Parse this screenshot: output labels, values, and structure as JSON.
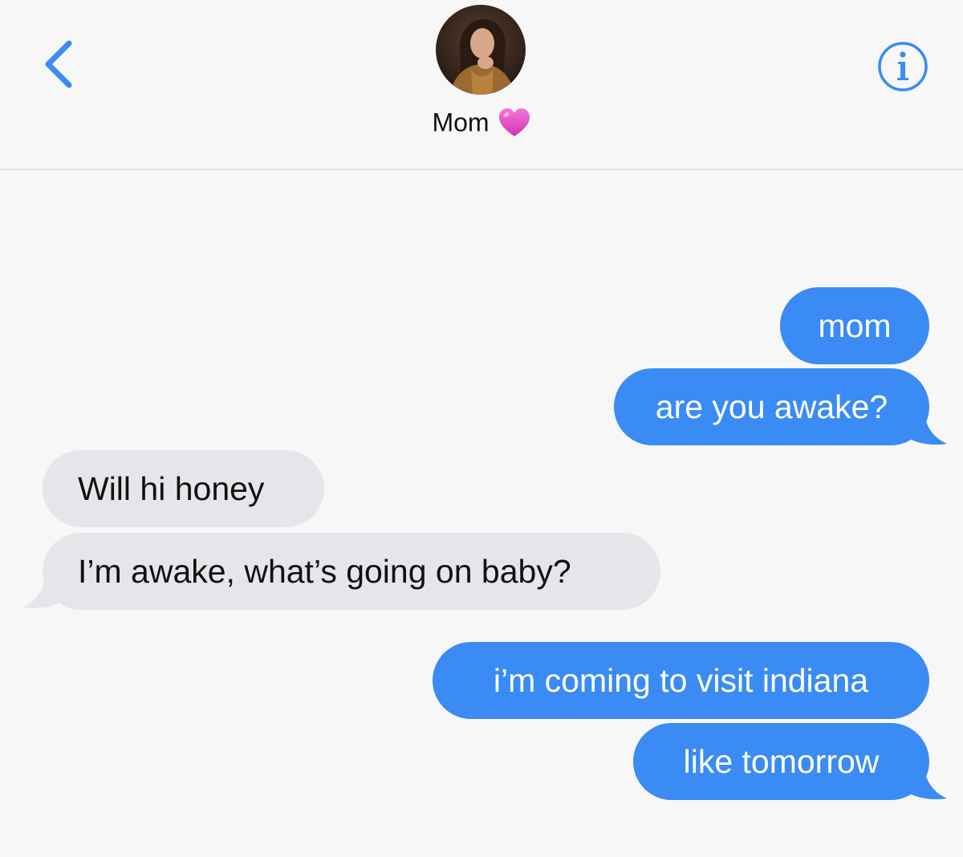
{
  "header": {
    "contact_name": "Mom",
    "contact_emoji": "pink-heart-icon",
    "back_icon": "chevron-left-icon",
    "info_icon": "info-icon",
    "accent_color": "#3a8bf3"
  },
  "messages": [
    {
      "direction": "sent",
      "text": "mom"
    },
    {
      "direction": "sent",
      "text": "are you awake?"
    },
    {
      "direction": "received",
      "text": "Will hi honey"
    },
    {
      "direction": "received",
      "text": "I’m awake, what’s going on baby?"
    },
    {
      "direction": "sent",
      "text": "i’m coming to visit indiana"
    },
    {
      "direction": "sent",
      "text": "like tomorrow"
    }
  ],
  "colors": {
    "sent_bubble": "#3a8bf3",
    "received_bubble": "#e6e5ea",
    "background": "#f7f7f7"
  }
}
